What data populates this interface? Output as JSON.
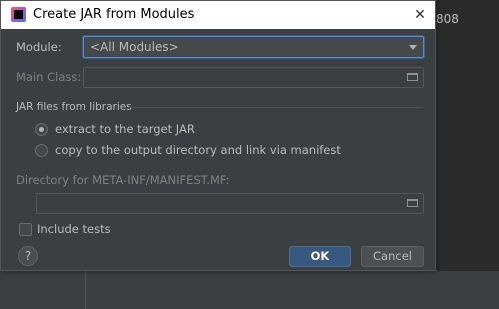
{
  "background": {
    "partial_text": "808"
  },
  "dialog": {
    "title": "Create JAR from Modules",
    "close_glyph": "✕",
    "module_label": "Module:",
    "module_value": "<All Modules>",
    "main_class_label": "Main Class:",
    "main_class_value": "",
    "libraries_section_label": "JAR files from libraries",
    "options": [
      {
        "label": "extract to the target JAR",
        "selected": true
      },
      {
        "label": "copy to the output directory and link via manifest",
        "selected": false
      }
    ],
    "manifest_dir_label": "Directory for META-INF/MANIFEST.MF:",
    "manifest_dir_value": "",
    "include_tests_label": "Include tests",
    "include_tests_checked": false,
    "help_label": "?",
    "ok_label": "OK",
    "cancel_label": "Cancel"
  },
  "colors": {
    "dialog_bg": "#3c3f41",
    "accent": "#4c8ed9",
    "ok_button": "#365880"
  }
}
